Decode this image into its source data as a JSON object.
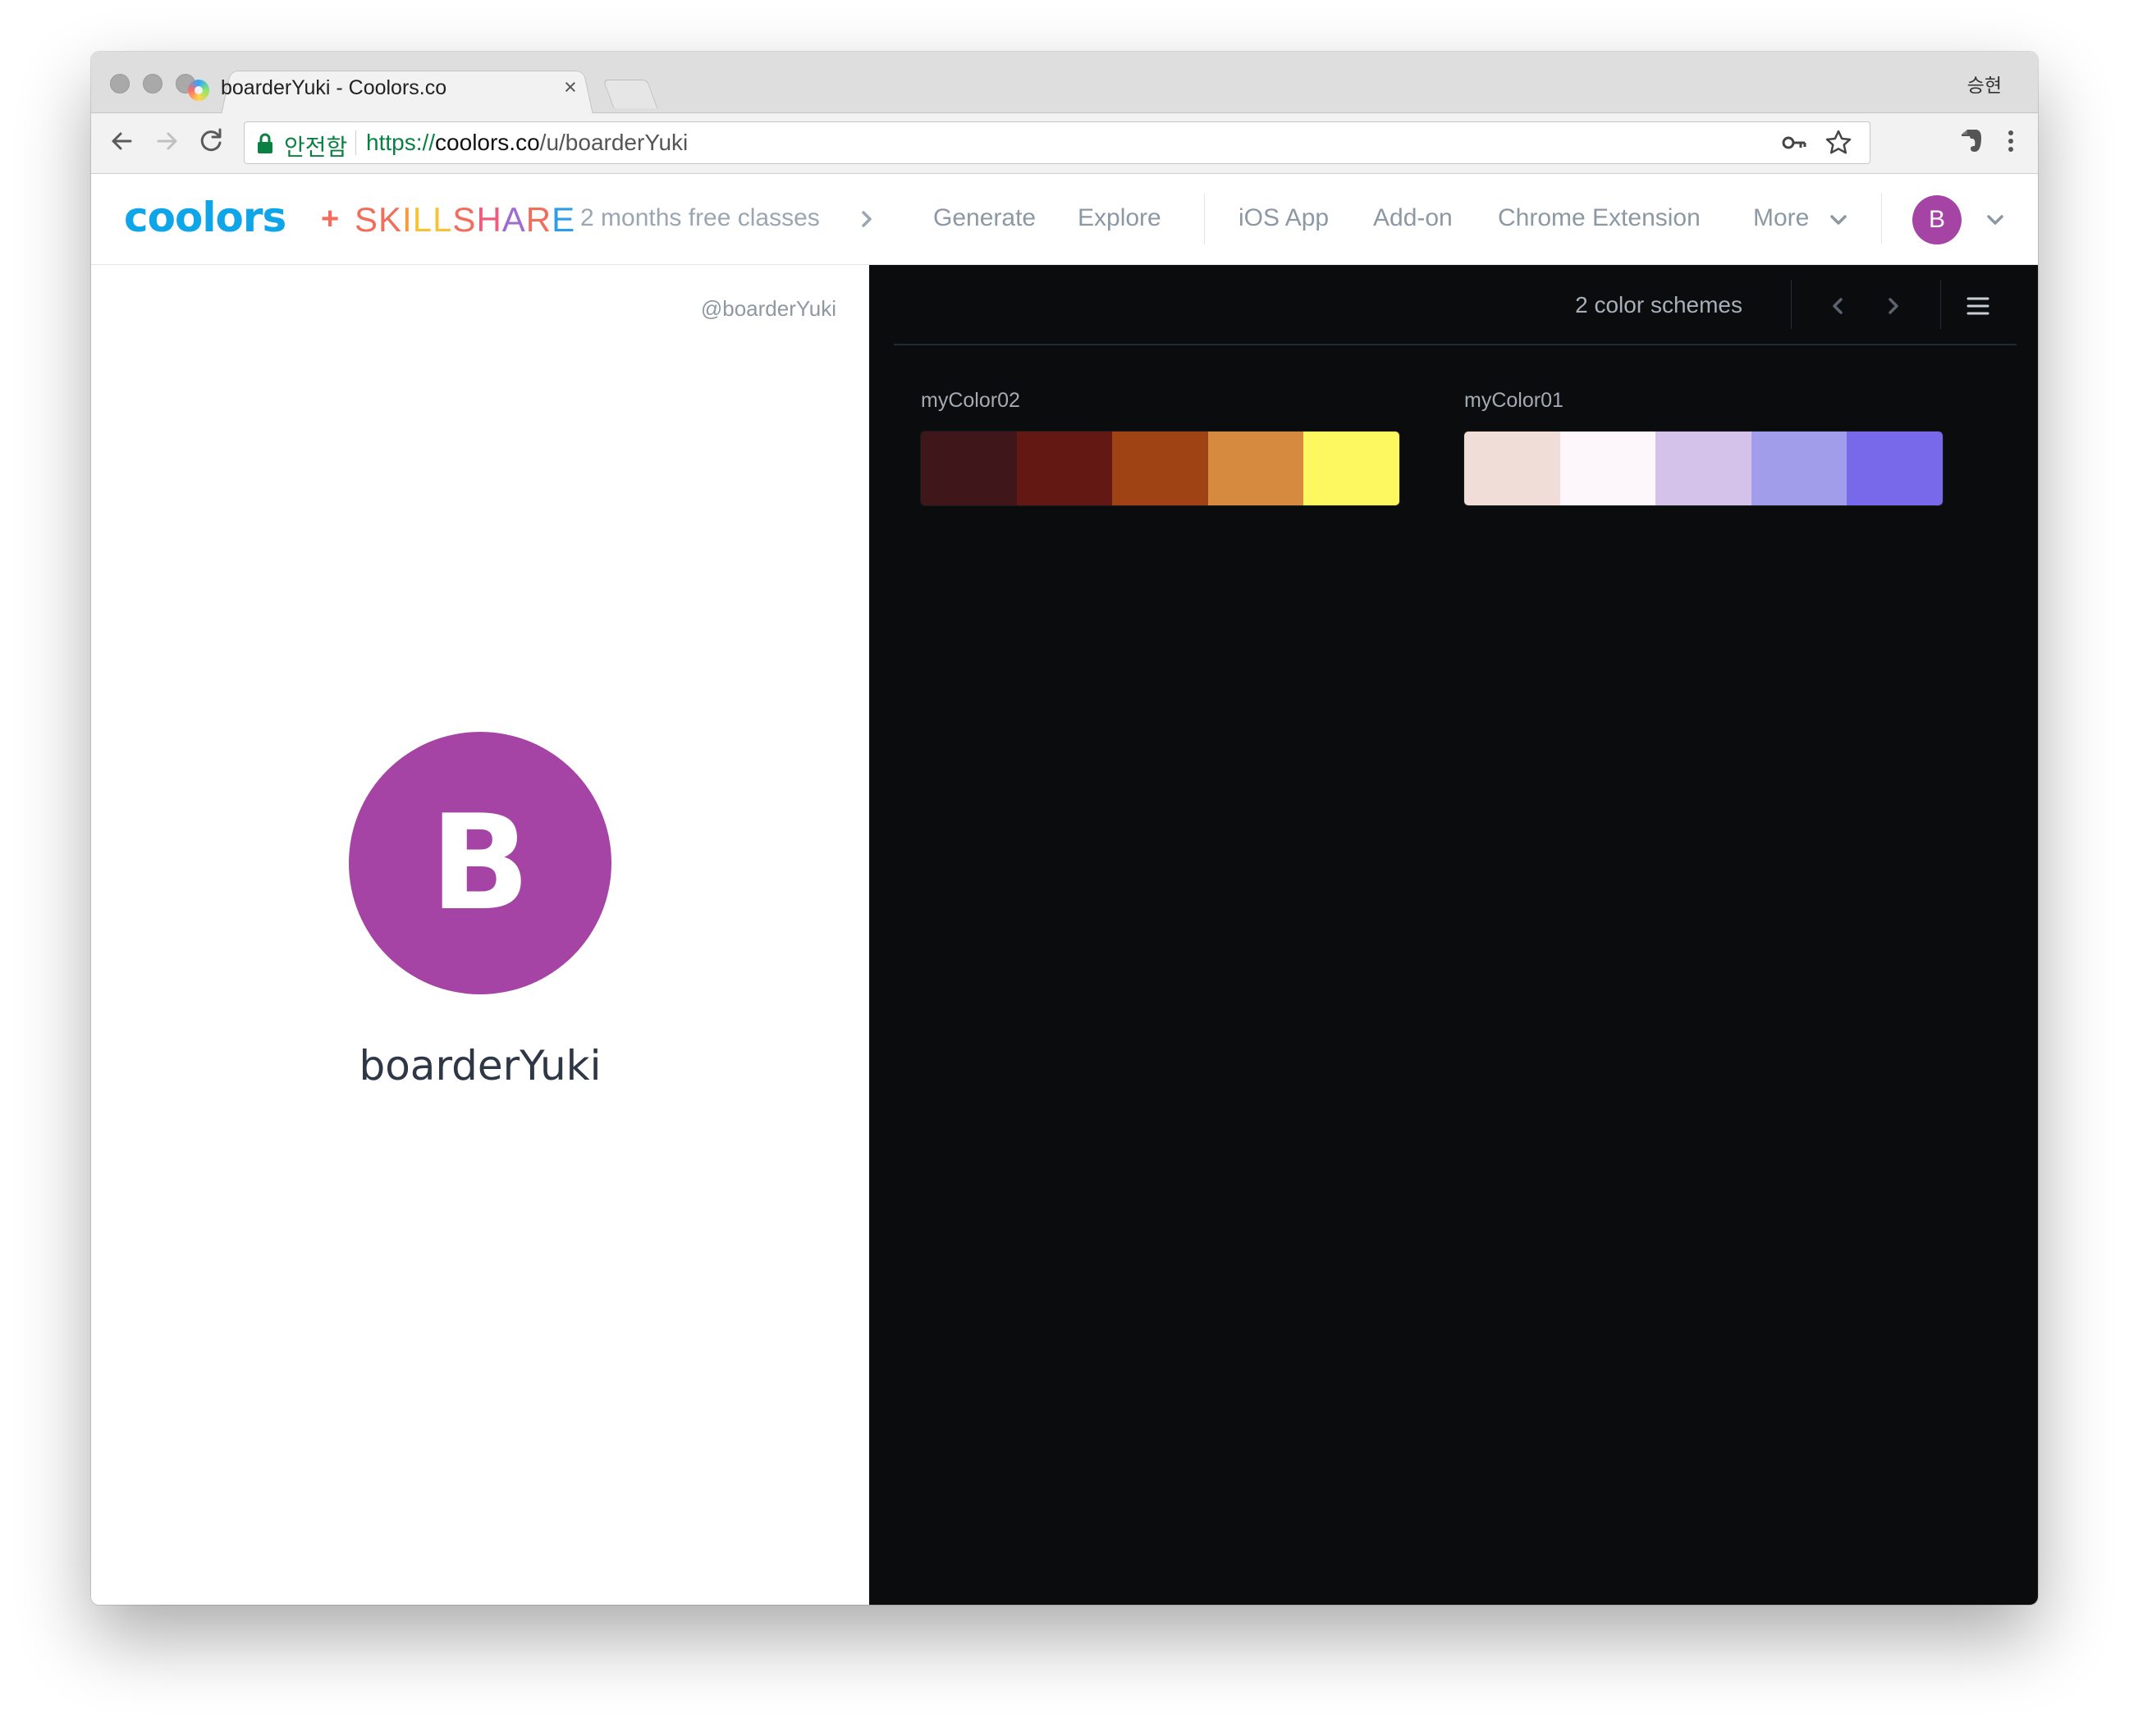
{
  "browser": {
    "tab_title": "boarderYuki - Coolors.co",
    "tab_close": "×",
    "profile_name": "승현",
    "secure_label": "안전함",
    "url_scheme": "https://",
    "url_host": "coolors.co",
    "url_path": "/u/boarderYuki"
  },
  "header": {
    "logo": "coolors",
    "plus": "+",
    "skillshare_letters": [
      {
        "ch": "S",
        "color": "#f26d5b"
      },
      {
        "ch": "K",
        "color": "#f26d5b"
      },
      {
        "ch": "I",
        "color": "#f79a3e"
      },
      {
        "ch": "L",
        "color": "#f7c234"
      },
      {
        "ch": "L",
        "color": "#f7c234"
      },
      {
        "ch": "S",
        "color": "#f26d5b"
      },
      {
        "ch": "H",
        "color": "#ef5b7c"
      },
      {
        "ch": "A",
        "color": "#a06bd0"
      },
      {
        "ch": "R",
        "color": "#f26d5b"
      },
      {
        "ch": "E",
        "color": "#2e9ce6"
      }
    ],
    "promo": "2 months free classes",
    "nav": {
      "generate": "Generate",
      "explore": "Explore",
      "ios_app": "iOS App",
      "add_on": "Add-on",
      "chrome_extension": "Chrome Extension",
      "more": "More"
    },
    "user_initial": "B"
  },
  "profile": {
    "handle": "@boarderYuki",
    "initial": "B",
    "username": "boarderYuki",
    "avatar_color": "#a544a4"
  },
  "schemes": {
    "count_label": "2 color schemes",
    "palettes": [
      {
        "name": "myColor02",
        "colors": [
          "#3f161a",
          "#641813",
          "#9f4214",
          "#d68a40",
          "#fdf85f"
        ]
      },
      {
        "name": "myColor01",
        "colors": [
          "#f1ddd7",
          "#fdf7fc",
          "#d5c2ea",
          "#a29deb",
          "#7769e9"
        ]
      }
    ]
  }
}
